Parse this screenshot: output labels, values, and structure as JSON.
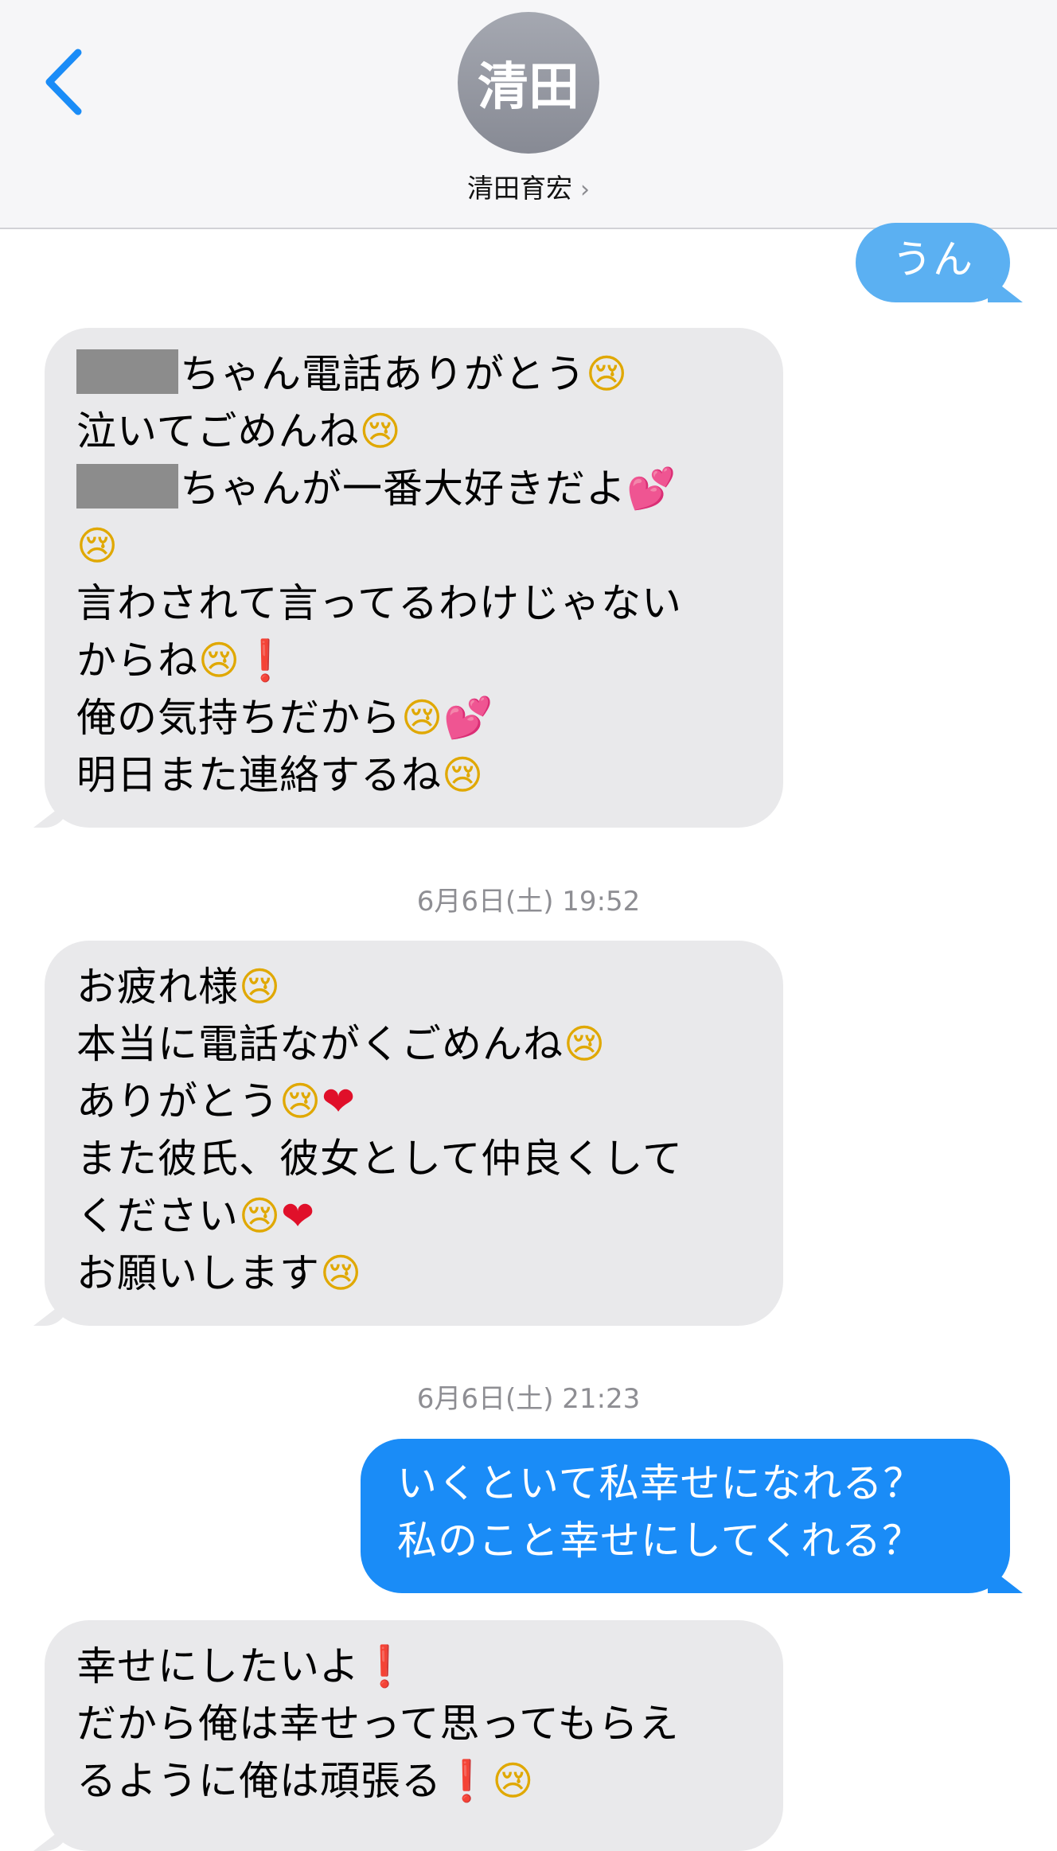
{
  "header": {
    "avatar_initials": "清田",
    "contact_name": "清田育宏",
    "chevron": "›",
    "back_icon": "chevron-left-icon"
  },
  "messages": {
    "m1": {
      "lines": [
        "うん"
      ]
    },
    "m2": {
      "line1": "ちゃん電話ありがとう",
      "line2": "泣いてごめんね",
      "line3": "ちゃんが一番大好きだよ",
      "line5": "言わされて言ってるわけじゃない",
      "line6": "からね",
      "line7": "俺の気持ちだから",
      "line8": "明日また連絡するね"
    },
    "ts1": "6月6日(土) 19:52",
    "m3": {
      "line1": "お疲れ様",
      "line2": "本当に電話ながくごめんね",
      "line3": "ありがとう",
      "line4": "また彼氏、彼女として仲良くして",
      "line5": "ください",
      "line6": "お願いします"
    },
    "ts2": "6月6日(土) 21:23",
    "m4": {
      "line1": "いくといて私幸せになれる？",
      "line2": "私のこと幸せにしてくれる？"
    },
    "m5": {
      "line1": "幸せにしたいよ",
      "line2": "だから俺は幸せって思ってもらえ",
      "line3": "るように俺は頑張る"
    }
  },
  "emoji": {
    "cry": "😢",
    "hearts": "💕",
    "heart": "❤",
    "exclaim": "❗"
  },
  "colors": {
    "sent_bubble": "#1a8cf7",
    "received_bubble": "#e9e9eb",
    "back_chevron": "#1a8cf7"
  }
}
